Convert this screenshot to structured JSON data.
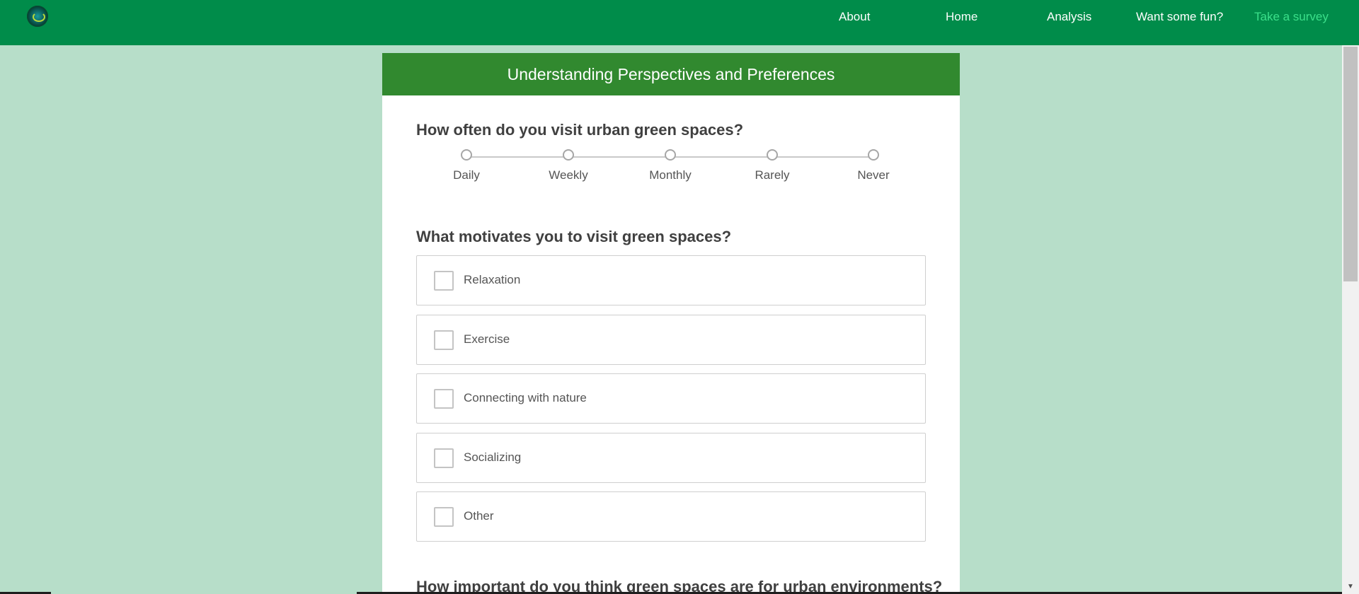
{
  "nav": {
    "logo_icon": "globe-logo",
    "links": [
      "About",
      "Home",
      "Analysis",
      "Want some fun?",
      "Take a survey"
    ],
    "active_link": "Take a survey",
    "colors": {
      "bar": "#008c4a",
      "active": "#3bdf8a"
    }
  },
  "survey": {
    "title": "Understanding Perspectives and Preferences",
    "header_color": "#31892f",
    "q1": {
      "text": "How often do you visit urban green spaces?",
      "options": [
        "Daily",
        "Weekly",
        "Monthly",
        "Rarely",
        "Never"
      ],
      "selected": null
    },
    "q2": {
      "text": "What motivates you to visit green spaces?",
      "options": [
        "Relaxation",
        "Exercise",
        "Connecting with nature",
        "Socializing",
        "Other"
      ],
      "checked": [
        false,
        false,
        false,
        false,
        false
      ]
    },
    "q3": {
      "text": "How important do you think green spaces are for urban environments?"
    }
  },
  "page": {
    "background": "#b7dec9"
  }
}
